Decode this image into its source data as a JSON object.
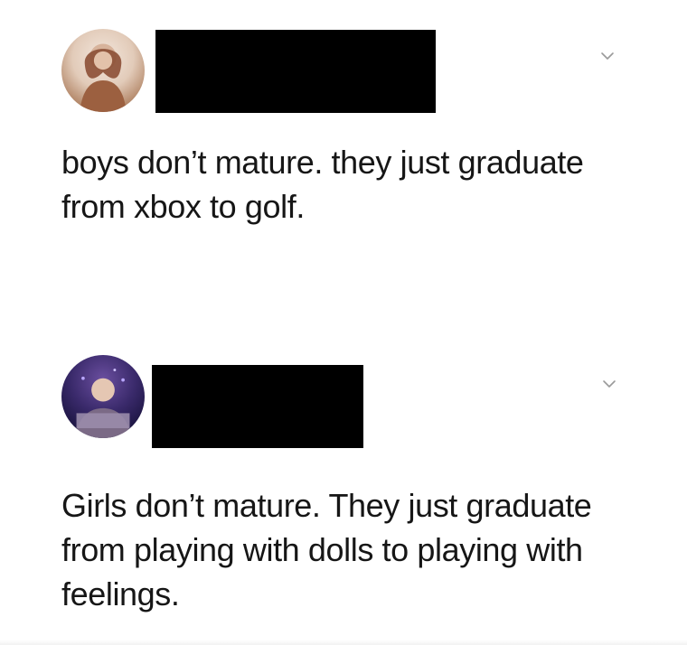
{
  "posts": [
    {
      "text": "boys don’t mature. they just graduate from xbox to golf.",
      "menu_icon": "chevron-down-icon"
    },
    {
      "text": "Girls don’t mature. They just graduate from playing with dolls to playing with feelings.",
      "menu_icon": "chevron-down-icon"
    }
  ]
}
